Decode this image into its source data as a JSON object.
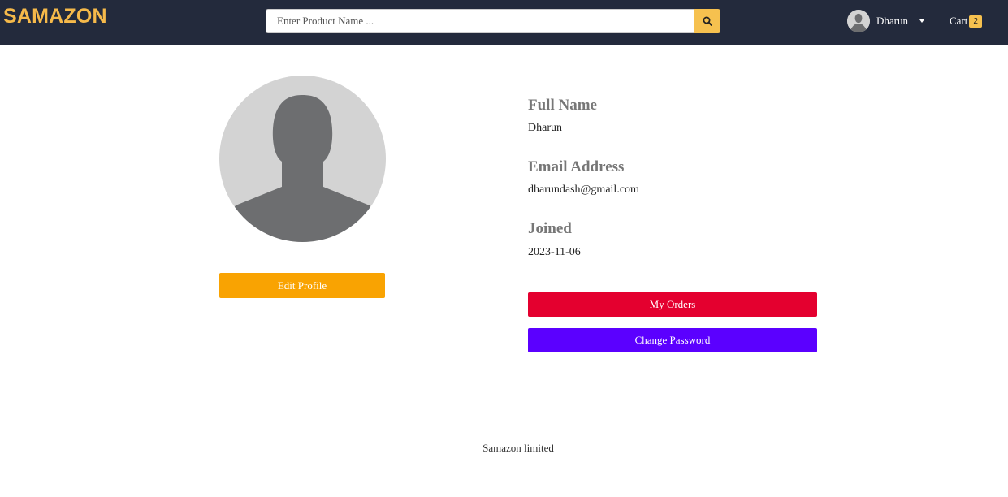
{
  "navbar": {
    "brand": "SAMAZON",
    "search": {
      "placeholder": "Enter Product Name ...",
      "value": ""
    },
    "search_icon": "search-icon",
    "user": {
      "name": "Dharun",
      "avatar_icon": "default-user-avatar"
    },
    "cart": {
      "label": "Cart",
      "count": "2"
    }
  },
  "profile": {
    "avatar_icon": "default-user-avatar",
    "edit_label": "Edit Profile",
    "fields": [
      {
        "label": "Full Name",
        "value": "Dharun"
      },
      {
        "label": "Email Address",
        "value": "dharundash@gmail.com"
      },
      {
        "label": "Joined",
        "value": "2023-11-06"
      }
    ],
    "my_orders_label": "My Orders",
    "change_password_label": "Change Password"
  },
  "footer": {
    "text": "Samazon limited"
  },
  "colors": {
    "navbar_bg": "#232a3c",
    "brand": "#f5b94a",
    "search_button": "#f6c14f",
    "edit_button": "#f9a302",
    "orders_button": "#e4002f",
    "password_button": "#5b00ff"
  }
}
